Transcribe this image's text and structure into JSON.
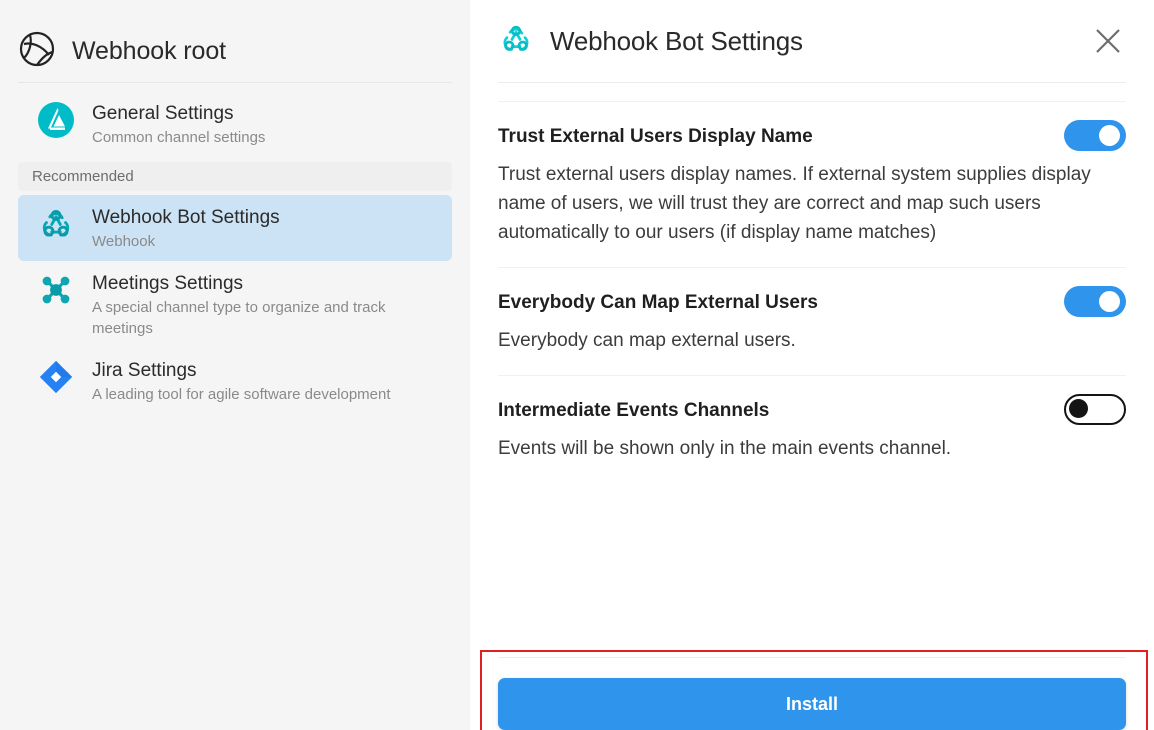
{
  "sidebar": {
    "header": {
      "title": "Webhook root",
      "icon": "globe-icon"
    },
    "group_label": "Recommended",
    "items": [
      {
        "name": "General Settings",
        "desc": "Common channel settings",
        "icon": "general-settings-icon",
        "selected": false
      },
      {
        "name": "Webhook Bot Settings",
        "desc": "Webhook",
        "icon": "webhook-icon",
        "selected": true
      },
      {
        "name": "Meetings Settings",
        "desc": "A special channel type to organize and track meetings",
        "icon": "meetings-icon",
        "selected": false
      },
      {
        "name": "Jira Settings",
        "desc": "A leading tool for agile software development",
        "icon": "jira-icon",
        "selected": false
      }
    ]
  },
  "panel": {
    "title": "Webhook Bot Settings",
    "icon": "webhook-icon",
    "close_label": "close-icon",
    "settings": [
      {
        "title": "Trust External Users Display Name",
        "desc": "Trust external users display names. If external system supplies display name of users, we will trust they are correct and map such users automatically to our users (if display name matches)",
        "toggle": "on"
      },
      {
        "title": "Everybody Can Map External Users",
        "desc": "Everybody can map external users.",
        "toggle": "on"
      },
      {
        "title": "Intermediate Events Channels",
        "desc": "Events will be shown only in the main events channel.",
        "toggle": "off"
      }
    ],
    "install_label": "Install"
  },
  "colors": {
    "accent_blue": "#2f94ec",
    "teal": "#00bcc8",
    "jira_blue": "#2681f2",
    "selected_bg": "#cce3f6",
    "annotation_red": "#e02020"
  }
}
